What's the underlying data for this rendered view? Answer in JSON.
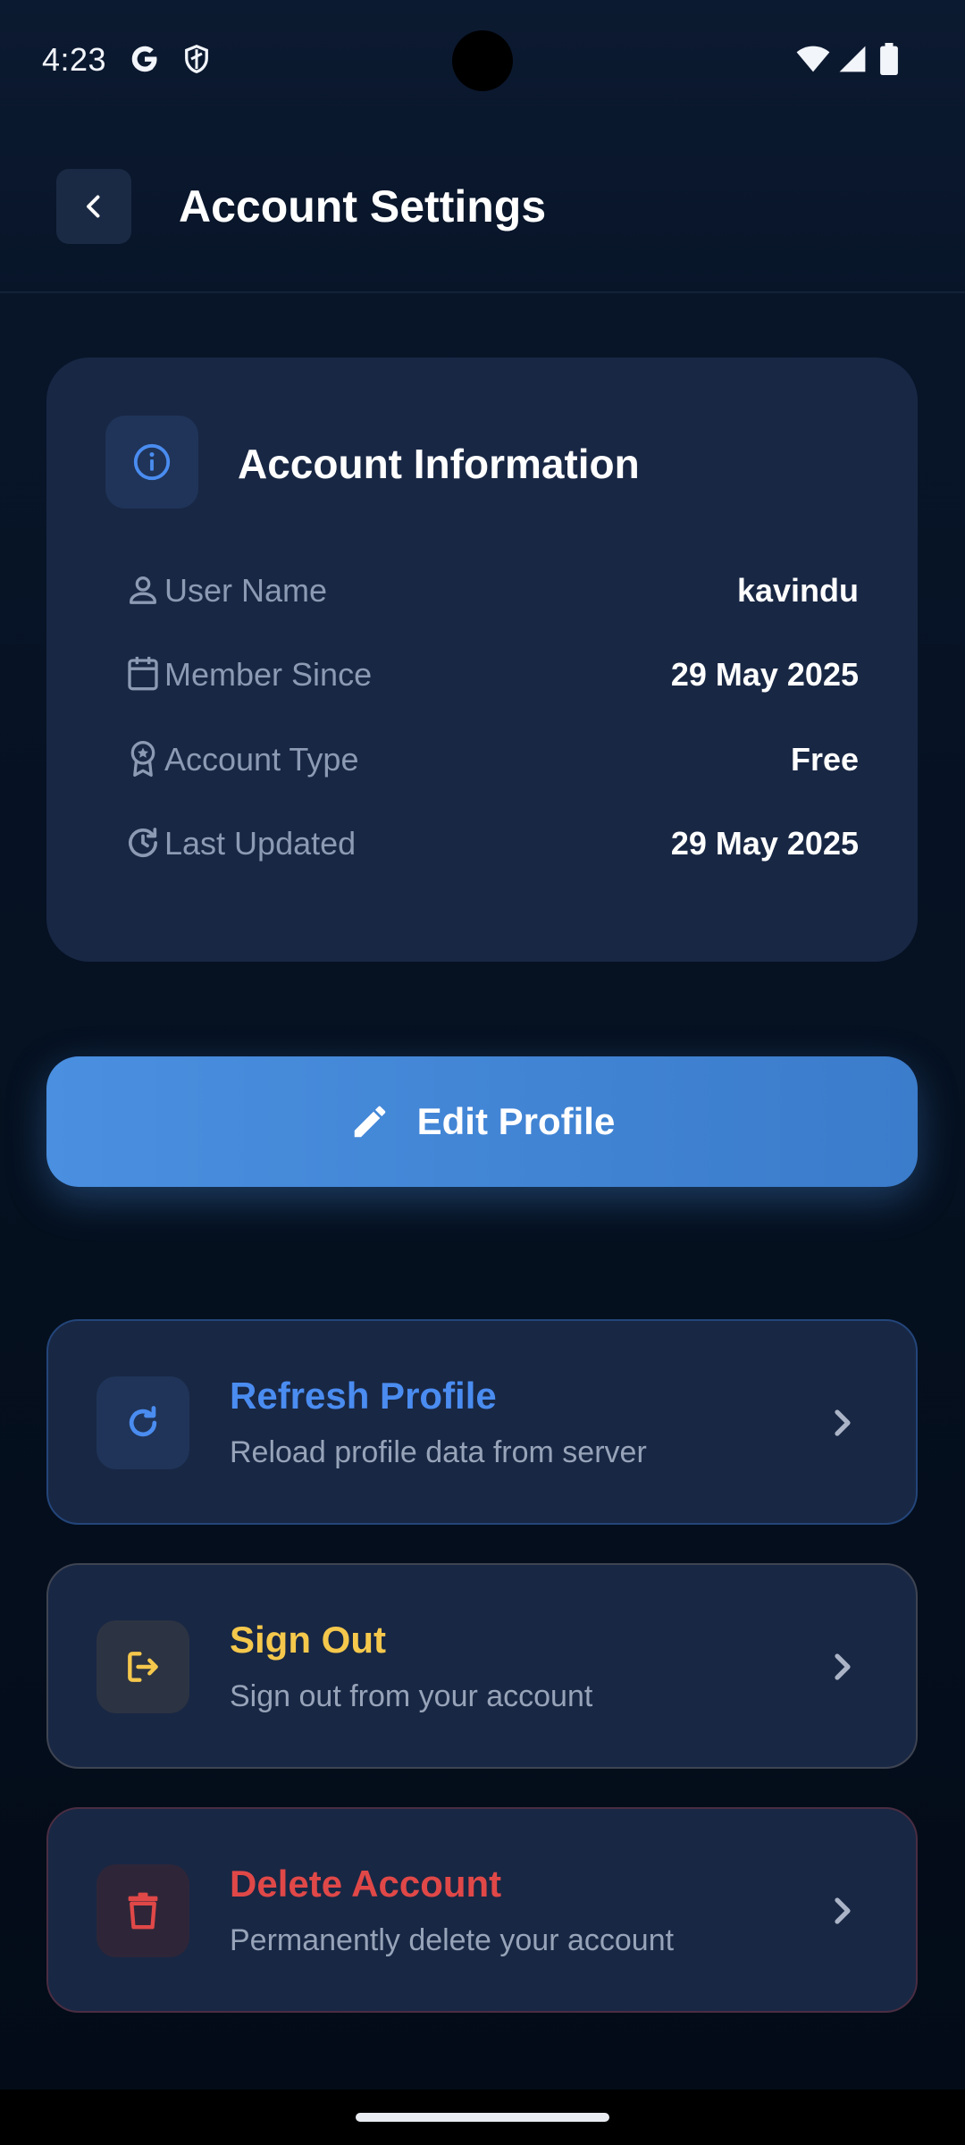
{
  "status_bar": {
    "time": "4:23"
  },
  "header": {
    "title": "Account Settings"
  },
  "account_info": {
    "title": "Account Information",
    "rows": [
      {
        "label": "User Name",
        "value": "kavindu",
        "icon": "person-icon"
      },
      {
        "label": "Member Since",
        "value": "29 May 2025",
        "icon": "calendar-icon"
      },
      {
        "label": "Account Type",
        "value": "Free",
        "icon": "award-icon"
      },
      {
        "label": "Last Updated",
        "value": "29 May 2025",
        "icon": "history-icon"
      }
    ]
  },
  "edit_button": {
    "label": "Edit Profile"
  },
  "actions": [
    {
      "title": "Refresh Profile",
      "subtitle": "Reload profile data from server",
      "color": "#4a8cf0",
      "icon": "refresh-icon"
    },
    {
      "title": "Sign Out",
      "subtitle": "Sign out from your account",
      "color": "#f5c84c",
      "icon": "logout-icon"
    },
    {
      "title": "Delete Account",
      "subtitle": "Permanently delete your account",
      "color": "#e04848",
      "icon": "trash-icon"
    }
  ],
  "colors": {
    "accent": "#4a8fe0",
    "card": "#182744",
    "background": "#061225"
  }
}
